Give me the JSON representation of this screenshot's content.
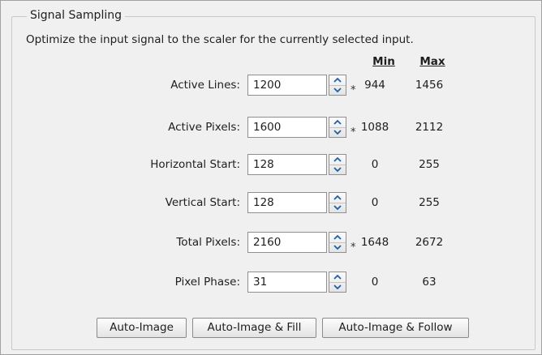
{
  "group": {
    "title": "Signal Sampling"
  },
  "description": "Optimize the input signal to the scaler for the currently selected input.",
  "columns": {
    "min": "Min",
    "max": "Max"
  },
  "rows": [
    {
      "label": "Active Lines:",
      "value": "1200",
      "star": "*",
      "min": "944",
      "max": "1456"
    },
    {
      "label": "Active Pixels:",
      "value": "1600",
      "star": "*",
      "min": "1088",
      "max": "2112"
    },
    {
      "label": "Horizontal Start:",
      "value": "128",
      "star": "",
      "min": "0",
      "max": "255"
    },
    {
      "label": "Vertical Start:",
      "value": "128",
      "star": "",
      "min": "0",
      "max": "255"
    },
    {
      "label": "Total Pixels:",
      "value": "2160",
      "star": "*",
      "min": "1648",
      "max": "2672"
    },
    {
      "label": "Pixel Phase:",
      "value": "31",
      "star": "",
      "min": "0",
      "max": "63"
    }
  ],
  "buttons": {
    "auto_image": "Auto-Image",
    "auto_image_fill": "Auto-Image & Fill",
    "auto_image_follow": "Auto-Image & Follow"
  },
  "colors": {
    "panel_bg": "#f0f0f0",
    "spinner_arrow": "#1f5fa8"
  },
  "icons": {
    "spin_up": "chevron-up-icon",
    "spin_down": "chevron-down-icon"
  }
}
